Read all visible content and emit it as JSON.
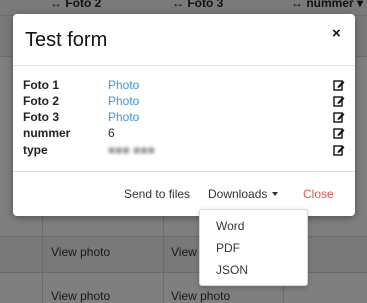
{
  "background": {
    "headers": [
      "↔ Foto 2",
      "↔ Foto 3",
      "↔ nummer ▾"
    ],
    "cells": [
      "View photo",
      "View",
      "View photo",
      "View photo"
    ]
  },
  "modal": {
    "title": "Test form",
    "close_symbol": "×",
    "fields": [
      {
        "label": "Foto 1",
        "value": "Photo"
      },
      {
        "label": "Foto 2",
        "value": "Photo"
      },
      {
        "label": "Foto 3",
        "value": "Photo"
      },
      {
        "label": "nummer",
        "value": "6"
      },
      {
        "label": "type",
        "value": "■■■ ■■■"
      }
    ],
    "footer": {
      "send_label": "Send to files",
      "downloads_label": "Downloads",
      "close_label": "Close"
    }
  },
  "downloads_menu": {
    "items": [
      "Word",
      "PDF",
      "JSON"
    ]
  },
  "colors": {
    "link": "#2a9fd8",
    "close": "#e5534b",
    "overlay": "rgba(0,0,0,0.5)"
  }
}
